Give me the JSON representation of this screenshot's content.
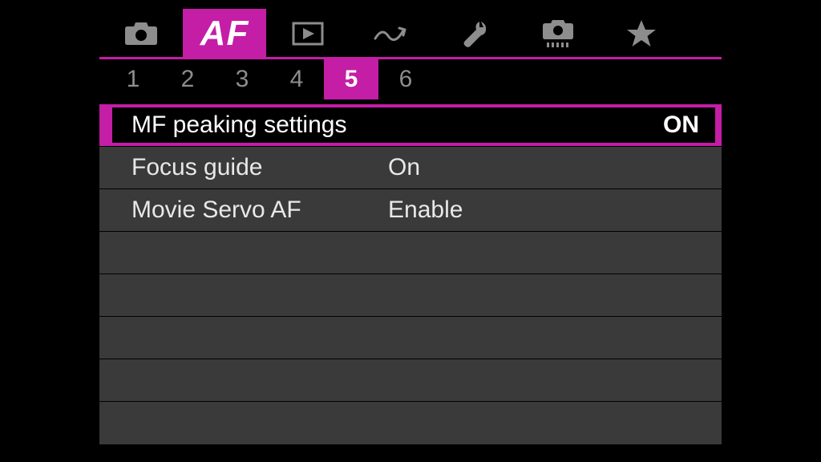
{
  "colors": {
    "accent": "#c41da6",
    "bg_row": "#3a3a3a",
    "inactive": "#8d8d8d"
  },
  "top_tabs": {
    "active_index": 1,
    "items": [
      {
        "name": "shooting-icon"
      },
      {
        "name": "af-icon",
        "label": "AF"
      },
      {
        "name": "playback-icon"
      },
      {
        "name": "network-icon"
      },
      {
        "name": "setup-icon"
      },
      {
        "name": "custom-icon"
      },
      {
        "name": "mymenu-icon"
      }
    ]
  },
  "page_tabs": {
    "active_index": 4,
    "items": [
      "1",
      "2",
      "3",
      "4",
      "5",
      "6"
    ]
  },
  "menu": {
    "selected_index": 0,
    "rows": [
      {
        "label": "MF peaking settings",
        "value": "ON"
      },
      {
        "label": "Focus guide",
        "value": "On"
      },
      {
        "label": "Movie Servo AF",
        "value": "Enable"
      },
      {
        "label": "",
        "value": ""
      },
      {
        "label": "",
        "value": ""
      },
      {
        "label": "",
        "value": ""
      },
      {
        "label": "",
        "value": ""
      },
      {
        "label": "",
        "value": ""
      }
    ]
  }
}
